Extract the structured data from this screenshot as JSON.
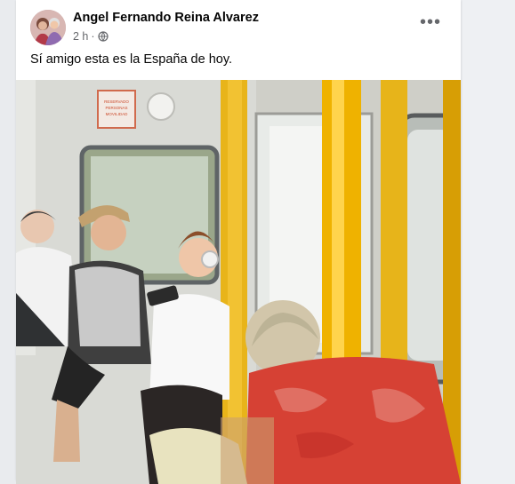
{
  "post": {
    "author": "Angel Fernando Reina Alvarez",
    "time": "2 h",
    "separator": "·",
    "caption": "Sí amigo esta es la España de hoy.",
    "more_label": "•••"
  },
  "photo_sign": {
    "line1": "RESERVADO",
    "line2": "PERSONAS",
    "line3": "MOVILIDAD"
  },
  "colors": {
    "pole": "#f2b300",
    "author": "#050505",
    "meta": "#65676b"
  }
}
